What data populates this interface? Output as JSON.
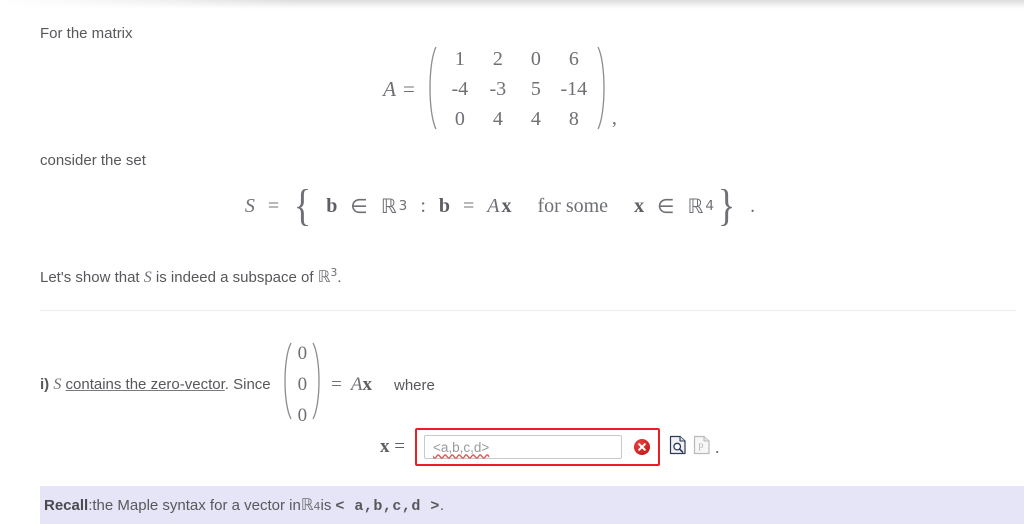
{
  "document": {
    "intro_line": "For the matrix",
    "consider_line": "consider the set",
    "matrix": {
      "name": "A",
      "equals": "=",
      "rows": [
        [
          "1",
          "2",
          "0",
          "6"
        ],
        [
          "-4",
          "-3",
          "5",
          "-14"
        ],
        [
          "0",
          "4",
          "4",
          "8"
        ]
      ],
      "trailing_punctuation": ","
    },
    "set_definition": {
      "set_name": "S",
      "equals": "=",
      "open_brace": "{",
      "element": "b",
      "element_in": "∈",
      "element_space": "ℝ",
      "element_space_exp": "3",
      "colon": ":",
      "condition_lhs": "b",
      "condition_eq": "=",
      "condition_rhs_matrix": "A",
      "condition_rhs_vector": "x",
      "quantifier": "for some",
      "variable": "x",
      "variable_in": "∈",
      "variable_space": "ℝ",
      "variable_space_exp": "4",
      "close_brace": "}",
      "trailing_punctuation": "."
    },
    "show_line": {
      "prefix": "Let's show that ",
      "set_name": "S",
      "middle": " is indeed a subspace of ",
      "space": "ℝ",
      "space_exp": "3",
      "suffix": "."
    },
    "part_i": {
      "marker": "i)",
      "set_name": "S",
      "underlined_phrase": "contains the zero-vector",
      "period": ".",
      "since": "Since",
      "zero_vector": [
        "0",
        "0",
        "0"
      ],
      "equals": "=",
      "matrix_name": "A",
      "vector_name": "x",
      "where": "where"
    },
    "answer_row": {
      "label_vector": "x",
      "label_equals": "=",
      "input_placeholder": "<a,b,c,d>",
      "input_value": "",
      "error_icon": "error-x-icon",
      "check_icon": "document-magnifier-icon",
      "plot_icon": "document-plot-icon",
      "trailing_punctuation": "."
    },
    "recall_bar": {
      "label": "Recall",
      "colon": ":",
      "text_before": " the Maple syntax for a vector in ",
      "space": "ℝ",
      "space_exp": "4",
      "text_is": " is",
      "syntax": "< a,b,c,d >",
      "trailing_punctuation": "."
    }
  },
  "colors": {
    "text": "#58585c",
    "math": "#6e7075",
    "error_red": "#ee1c24",
    "recall_background": "#e6e4f7",
    "divider": "#ececec",
    "field_border": "#c9c9c9"
  }
}
